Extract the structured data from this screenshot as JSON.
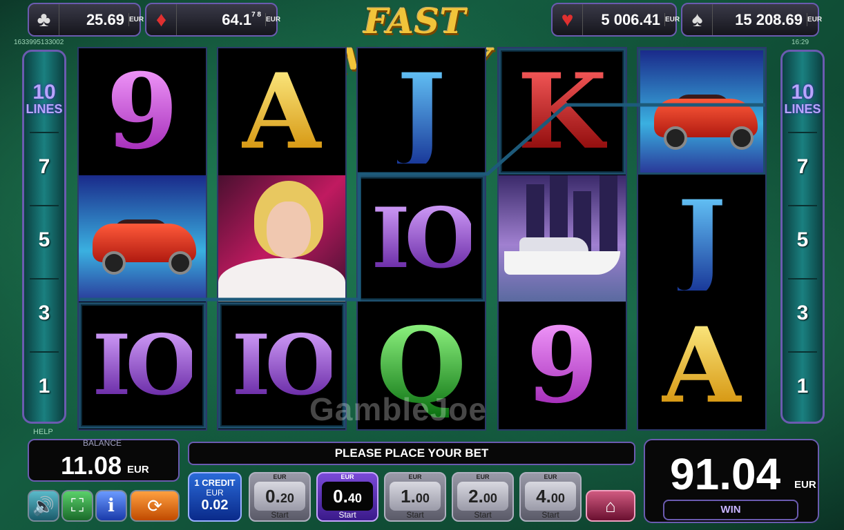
{
  "jackpots": [
    {
      "suit_icon": "club-icon",
      "glyph": "♣",
      "value": "25.69",
      "currency": "EUR"
    },
    {
      "suit_icon": "diamond-icon",
      "glyph": "♦",
      "value": "64.1",
      "value_extra": "7 8",
      "currency": "EUR"
    },
    {
      "suit_icon": "heart-icon",
      "glyph": "♥",
      "value": "5 006.41",
      "currency": "EUR"
    },
    {
      "suit_icon": "spade-icon",
      "glyph": "♠",
      "value": "15 208.69",
      "currency": "EUR"
    }
  ],
  "logo_text": "FAST MONEY",
  "session_id": "1633995133002",
  "clock": "16:29",
  "lines_panel": {
    "count": "10",
    "label": "LINES",
    "numbers": [
      "7",
      "5",
      "3",
      "1"
    ]
  },
  "reels": [
    [
      "9",
      "car",
      "10"
    ],
    [
      "A",
      "lady",
      "10"
    ],
    [
      "J",
      "10",
      "Q"
    ],
    [
      "K",
      "yacht",
      "9"
    ],
    [
      "car",
      "J",
      "A"
    ]
  ],
  "watermark": "GambleJoe",
  "help_label": "HELP",
  "balance": {
    "label": "BALANCE",
    "value": "11.08",
    "currency": "EUR"
  },
  "message": "PLEASE PLACE YOUR BET",
  "win": {
    "value": "91.04",
    "currency": "EUR",
    "label": "WIN"
  },
  "credit": {
    "line1": "1 CREDIT",
    "line2": "EUR",
    "value": "0.02"
  },
  "bets": [
    {
      "cur": "EUR",
      "int": "0.",
      "dec": "20",
      "start": "Start",
      "active": false
    },
    {
      "cur": "EUR",
      "int": "0.",
      "dec": "40",
      "start": "Start",
      "active": true
    },
    {
      "cur": "EUR",
      "int": "1.",
      "dec": "00",
      "start": "Start",
      "active": false
    },
    {
      "cur": "EUR",
      "int": "2.",
      "dec": "00",
      "start": "Start",
      "active": false
    },
    {
      "cur": "EUR",
      "int": "4.",
      "dec": "00",
      "start": "Start",
      "active": false
    }
  ],
  "controls": [
    {
      "name": "sound-icon",
      "glyph": "🔊",
      "color": "#3a8aa0"
    },
    {
      "name": "fullscreen-icon",
      "glyph": "⛶",
      "color": "#2aa040"
    },
    {
      "name": "info-icon",
      "glyph": "i",
      "color": "#3a6ad8"
    },
    {
      "name": "autoplay-icon",
      "glyph": "⟳",
      "color": "#e07020"
    }
  ],
  "home_icon": "home-icon"
}
